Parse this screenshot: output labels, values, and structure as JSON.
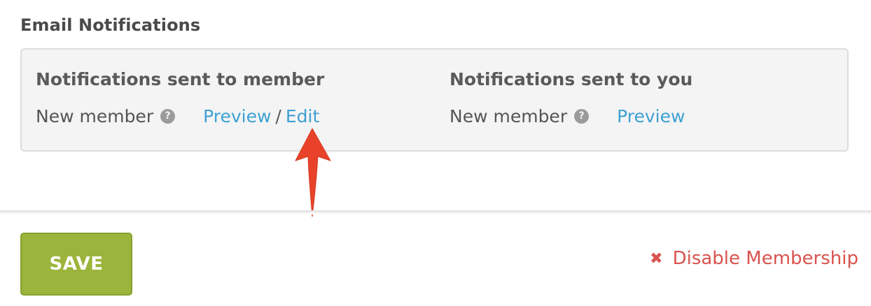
{
  "email_notifications": {
    "title": "Email Notifications",
    "member_column": {
      "heading": "Notifications sent to member",
      "item_label": "New member",
      "help_icon": "?",
      "preview_link": "Preview",
      "separator": "/",
      "edit_link": "Edit"
    },
    "you_column": {
      "heading": "Notifications sent to you",
      "item_label": "New member",
      "help_icon": "?",
      "preview_link": "Preview"
    }
  },
  "footer": {
    "save_label": "SAVE",
    "disable_icon": "✖",
    "disable_label": "Disable Membership"
  },
  "colors": {
    "link": "#3ea0d3",
    "save_button": "#9bb53c",
    "danger": "#d9534f",
    "annotation_arrow": "#e8432a"
  },
  "annotation": {
    "icon": "red-arrow-pointing-up"
  }
}
